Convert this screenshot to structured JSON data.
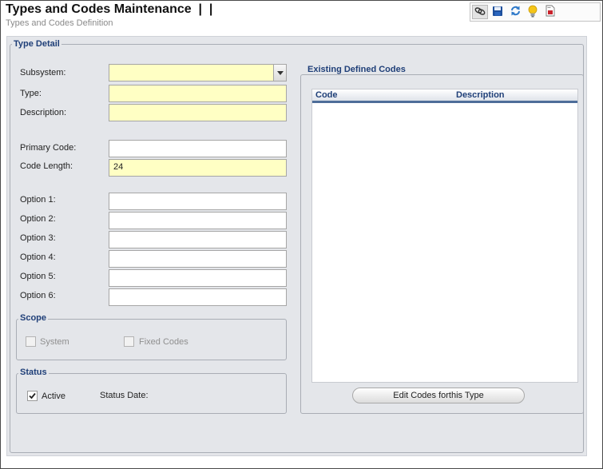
{
  "header": {
    "title": "Types and Codes Maintenance  |  |",
    "subtitle": "Types and Codes Definition"
  },
  "toolbar": {
    "buttons": [
      {
        "icon": "link-icon"
      },
      {
        "icon": "save-icon"
      },
      {
        "icon": "refresh-icon"
      },
      {
        "icon": "lightbulb-icon"
      },
      {
        "icon": "report-icon"
      }
    ]
  },
  "type_detail": {
    "heading": "Type Detail",
    "subsystem": {
      "label": "Subsystem:",
      "value": ""
    },
    "type": {
      "label": "Type:",
      "value": ""
    },
    "description": {
      "label": "Description:",
      "value": ""
    },
    "primary_code": {
      "label": "Primary Code:",
      "value": ""
    },
    "code_length": {
      "label": "Code Length:",
      "value": "24"
    },
    "options": [
      {
        "label": "Option 1:",
        "value": ""
      },
      {
        "label": "Option 2:",
        "value": ""
      },
      {
        "label": "Option 3:",
        "value": ""
      },
      {
        "label": "Option 4:",
        "value": ""
      },
      {
        "label": "Option 5:",
        "value": ""
      },
      {
        "label": "Option 6:",
        "value": ""
      }
    ]
  },
  "scope": {
    "heading": "Scope",
    "system": {
      "label": "System",
      "checked": false
    },
    "fixed_codes": {
      "label": "Fixed Codes",
      "checked": false
    }
  },
  "status": {
    "heading": "Status",
    "active": {
      "label": "Active",
      "checked": true
    },
    "status_date_label": "Status Date:"
  },
  "existing_codes": {
    "heading": "Existing Defined Codes",
    "columns": [
      "Code",
      "Description"
    ],
    "rows": [],
    "edit_button_label": "Edit Codes forthis Type"
  },
  "colors": {
    "section_heading": "#1f3f78",
    "required_field": "#ffffc4",
    "panel_background": "#e4e6ea",
    "grid_header_underline": "#4e6d99"
  }
}
